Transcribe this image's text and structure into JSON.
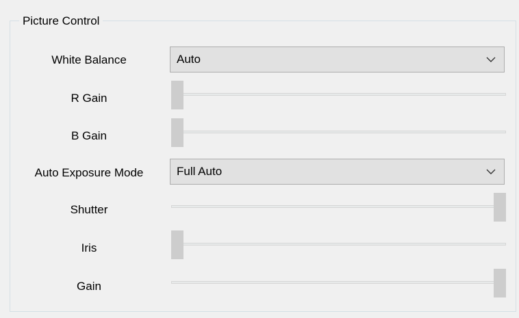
{
  "group_title": "Picture Control",
  "white_balance": {
    "label": "White Balance",
    "value": "Auto"
  },
  "r_gain": {
    "label": "R Gain",
    "level": 0.0
  },
  "b_gain": {
    "label": "B Gain",
    "level": 0.0
  },
  "auto_exposure_mode": {
    "label": "Auto Exposure Mode",
    "value": "Full Auto"
  },
  "shutter": {
    "label": "Shutter",
    "level": 1.0
  },
  "iris": {
    "label": "Iris",
    "level": 0.0
  },
  "gain": {
    "label": "Gain",
    "level": 1.0
  },
  "icons": {
    "dropdown_arrow": "chevron-down-icon"
  }
}
